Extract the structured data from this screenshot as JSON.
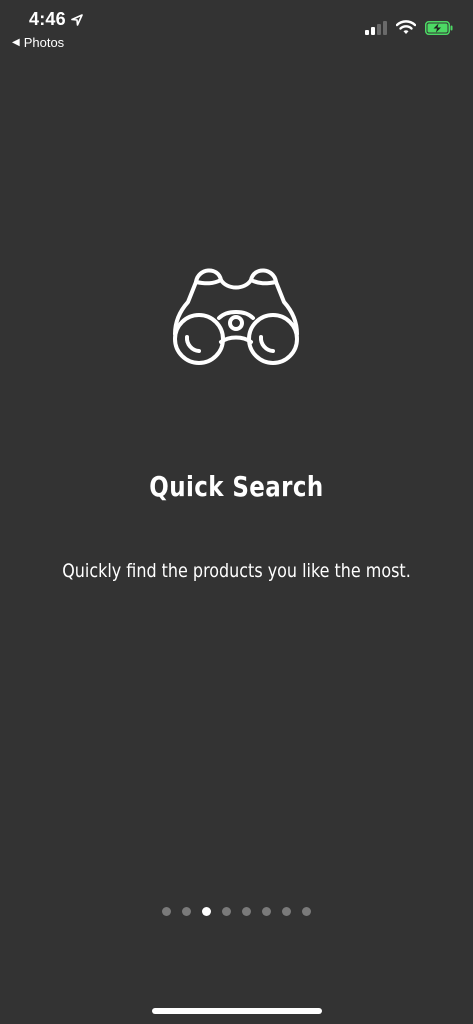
{
  "status_bar": {
    "time": "4:46",
    "back_label": "Photos",
    "battery_color": "#4cd964"
  },
  "onboarding": {
    "icon": "binoculars-icon",
    "title": "Quick Search",
    "subtitle": "Quickly find the products you like the most."
  },
  "pager": {
    "total_pages": 8,
    "current_page": 3
  }
}
